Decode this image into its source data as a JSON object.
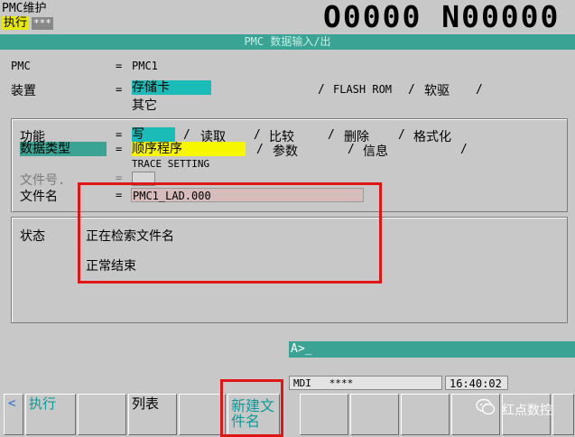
{
  "header": {
    "mode_title": "PMC维护",
    "mode_state": "执行",
    "mode_stars": "***",
    "program_numbers": "O0000 N00000"
  },
  "title_bar": "PMC 数据输入/出",
  "form": {
    "pmc_label": "PMC",
    "pmc_value": "PMC1",
    "device_label": "装置",
    "device_options": [
      "存储卡",
      "FLASH ROM",
      "软驱"
    ],
    "device_other": "其它",
    "function_label": "功能",
    "function_options": [
      "写",
      "读取",
      "比较",
      "删除",
      "格式化"
    ],
    "datatype_label": "数据类型",
    "datatype_options": [
      "顺序程序",
      "参数",
      "信息"
    ],
    "trace_setting": "TRACE SETTING",
    "fileno_label": "文件号.",
    "filename_label": "文件名",
    "filename_value": "PMC1_LAD.000",
    "eq": "="
  },
  "status": {
    "label": "状态",
    "line1": "正在检索文件名",
    "line2": "正常结束"
  },
  "command_line": "A>_",
  "status_line": {
    "mode": "MDI",
    "stars": "****",
    "time": "16:40:02"
  },
  "softkeys": {
    "left_arrow": "<",
    "execute": "执行",
    "list": "列表",
    "new_file": "新建文件名"
  },
  "watermark": "红点数控",
  "colors": {
    "teal": "#3aa394",
    "cyan": "#1bbcb8",
    "yellow": "#f7f700",
    "red_highlight": "#e01616",
    "pink_field": "#d8bcbc"
  }
}
